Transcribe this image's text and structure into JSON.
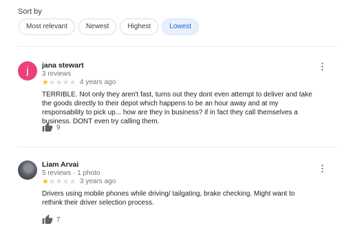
{
  "sort": {
    "label": "Sort by",
    "options": [
      "Most relevant",
      "Newest",
      "Highest",
      "Lowest"
    ],
    "selected": "Lowest"
  },
  "reviews": [
    {
      "avatar_letter": "j",
      "avatar_color": "#ec407a",
      "name": "jana stewart",
      "meta": "3 reviews",
      "rating": 1,
      "rating_max": 5,
      "date": "4 years ago",
      "text": "TERRIBLE. Not only they aren't fast, turns out they dont even attempt to deliver and take the goods directly to their depot which happens to be an hour away and at my responsability to pick up... how are they in business? if in fact they call themselves a business. DONT even try calling them.",
      "likes": "9"
    },
    {
      "avatar_letter": "",
      "name": "Liam Arvai",
      "meta": "5 reviews · 1 photo",
      "rating": 1,
      "rating_max": 5,
      "date": "3 years ago",
      "text": "Drivers using mobile phones while driving/ tailgating, brake checking. Might want to rethink their driver selection process.",
      "likes": "7"
    }
  ],
  "colors": {
    "star_on": "#fbbc04",
    "star_off": "#dadce0",
    "chip_active_bg": "#e8f0fe",
    "chip_active_text": "#1967d2"
  },
  "icons": {
    "more": "more-vert-icon",
    "like": "thumb-up-icon",
    "star": "star-icon"
  }
}
